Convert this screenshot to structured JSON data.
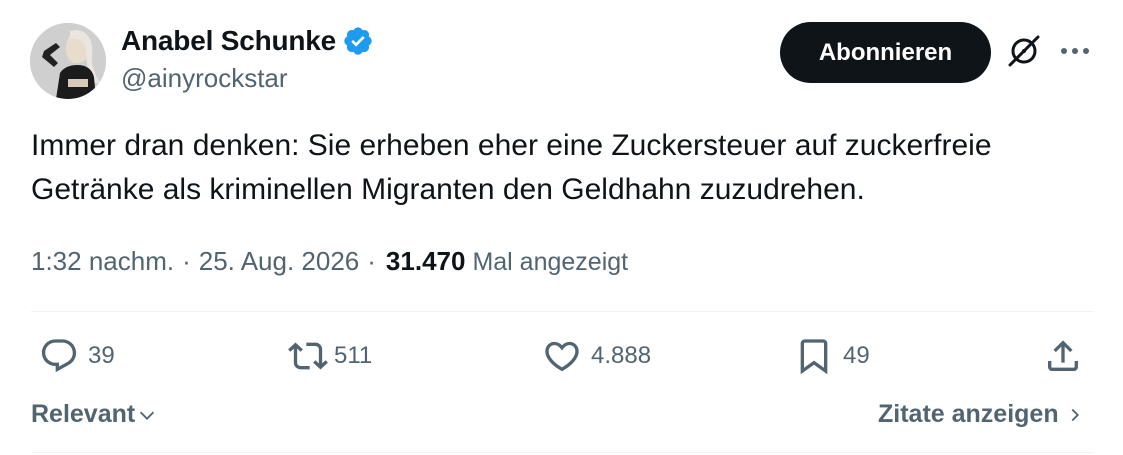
{
  "author": {
    "name": "Anabel Schunke",
    "handle": "@ainyrockstar",
    "verified_color": "#1d9bf0"
  },
  "header": {
    "subscribe_label": "Abonnieren",
    "icons": [
      "grok-icon",
      "more-icon"
    ]
  },
  "tweet": {
    "text": "Immer dran denken: Sie erheben eher eine Zuckersteuer auf zuckerfreie Getränke als kriminellen Migranten den Geldhahn zuzudrehen."
  },
  "meta": {
    "time": "1:32 nachm.",
    "separator": "·",
    "date": "25. Aug. 2026",
    "views_count": "31.470",
    "views_label": "Mal angezeigt"
  },
  "actions": {
    "replies": "39",
    "reposts": "511",
    "likes": "4.888",
    "bookmarks": "49"
  },
  "footer": {
    "relevant_label": "Relevant",
    "quotes_label": "Zitate anzeigen"
  },
  "colors": {
    "text": "#0f1419",
    "secondary": "#536471",
    "button_bg": "#0f1419",
    "divider": "#eff3f4"
  }
}
